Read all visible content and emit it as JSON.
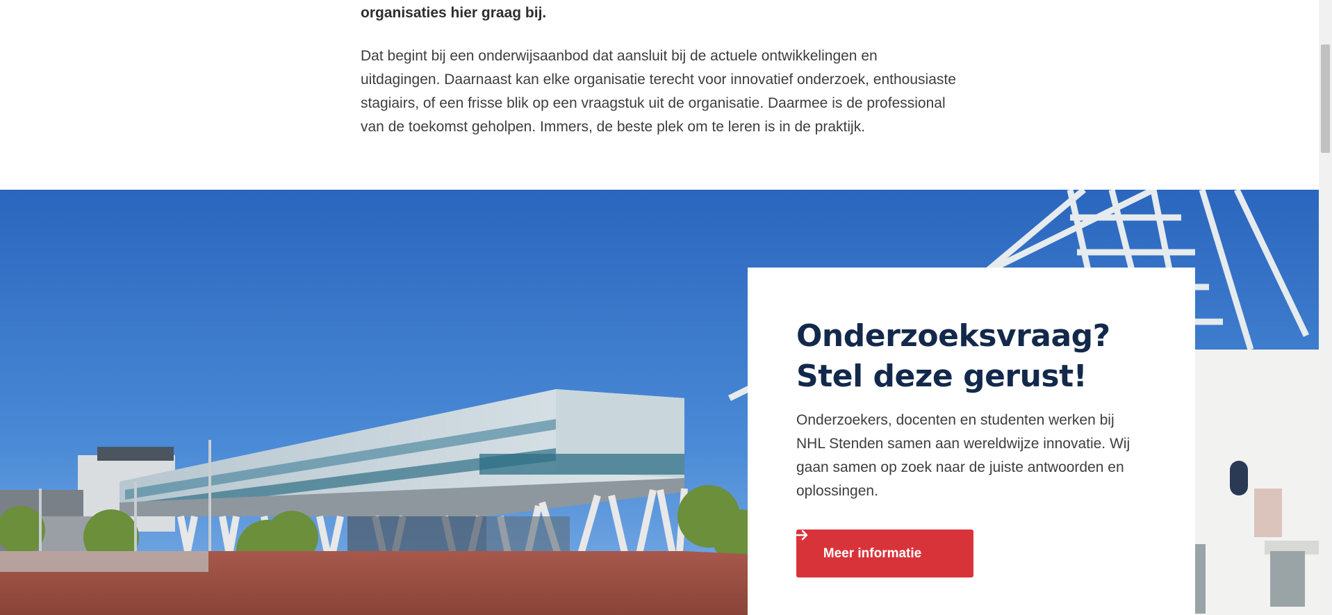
{
  "intro": {
    "lead": "organisaties hier graag bij.",
    "body": "Dat begint bij een onderwijsaanbod dat aansluit bij de actuele ontwikkelingen en uitdagingen. Daarnaast kan elke organisatie terecht voor innovatief onderzoek, enthousiaste stagiairs, of een frisse blik op een vraagstuk uit de organisatie. Daarmee is de professional van de toekomst geholpen. Immers, de beste plek om te leren is in de praktijk."
  },
  "card": {
    "title": "Onderzoeksvraag? Stel deze gerust!",
    "text": "Onderzoekers, docenten en studenten werken bij NHL Stenden samen aan wereldwijze innovatie. Wij gaan samen op zoek naar de juiste antwoorden en oplossingen.",
    "button_label": "Meer informatie",
    "button_icon": "arrow-right-icon"
  },
  "colors": {
    "title": "#13294b",
    "button": "#d9333a",
    "sky": "#2f6fc4"
  }
}
